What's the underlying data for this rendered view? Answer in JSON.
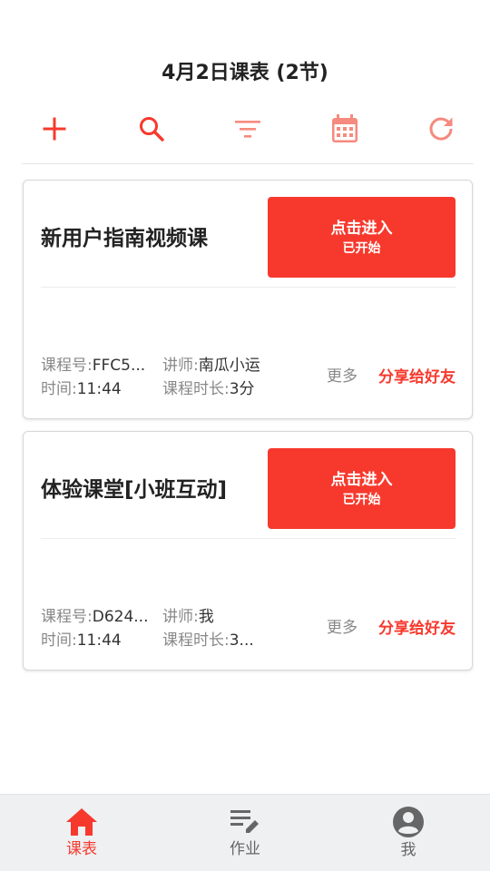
{
  "header": {
    "title": "4月2日课表 (2节)"
  },
  "toolbar": {
    "accent_color": "#f7392d",
    "muted_color": "#f58a7e",
    "items": [
      {
        "icon": "plus-icon"
      },
      {
        "icon": "search-icon"
      },
      {
        "icon": "filter-icon"
      },
      {
        "icon": "calendar-icon"
      },
      {
        "icon": "refresh-icon"
      }
    ]
  },
  "lessons": [
    {
      "title": "新用户指南视频课",
      "enter_label": "点击进入",
      "enter_status": "已开始",
      "code_label": "课程号:",
      "code_value": "FFC5...",
      "teacher_label": "讲师:",
      "teacher_value": "南瓜小运",
      "time_label": "时间:",
      "time_value": "11:44",
      "duration_label": "课程时长:",
      "duration_value": "3分",
      "more_label": "更多",
      "share_label": "分享给好友"
    },
    {
      "title": "体验课堂[小班互动]",
      "enter_label": "点击进入",
      "enter_status": "已开始",
      "code_label": "课程号:",
      "code_value": "D624...",
      "teacher_label": "讲师:",
      "teacher_value": "我",
      "time_label": "时间:",
      "time_value": "11:44",
      "duration_label": "课程时长:",
      "duration_value": "3...",
      "more_label": "更多",
      "share_label": "分享给好友"
    }
  ],
  "bottom_nav": {
    "items": [
      {
        "label": "课表",
        "icon": "home-icon",
        "active": true
      },
      {
        "label": "作业",
        "icon": "homework-edit-icon",
        "active": false
      },
      {
        "label": "我",
        "icon": "user-avatar-icon",
        "active": false
      }
    ]
  }
}
